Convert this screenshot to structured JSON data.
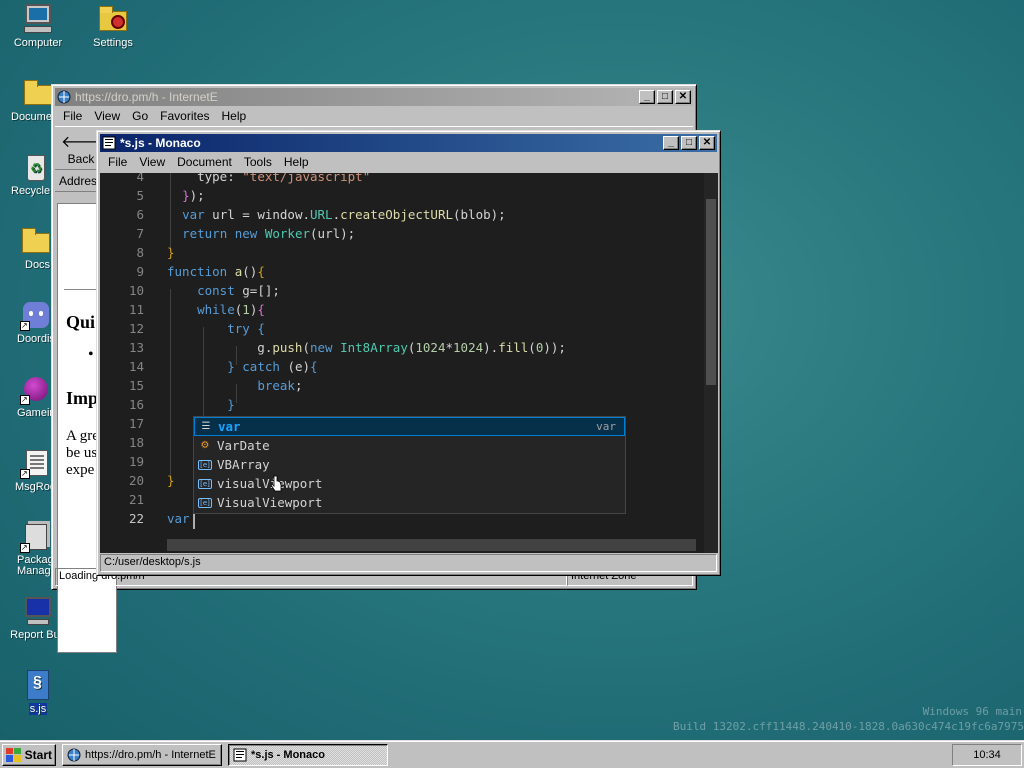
{
  "desktop": {
    "icons": [
      {
        "label": "Computer",
        "icon": "computer-icon"
      },
      {
        "label": "Settings",
        "icon": "settings-icon"
      },
      {
        "label": "Docume",
        "icon": "folder-icon"
      },
      {
        "label": "Recycle",
        "icon": "recycle-bin-icon"
      },
      {
        "label": "Docs",
        "icon": "folder-icon"
      },
      {
        "label": "Doordis",
        "icon": "discord-icon"
      },
      {
        "label": "Gamein",
        "icon": "gamein-icon"
      },
      {
        "label": "MsgRoo",
        "icon": "msgroom-icon"
      },
      {
        "label": "Packag\nManag",
        "icon": "package-manager-icon"
      },
      {
        "label": "Report Bug",
        "icon": "report-bug-icon"
      },
      {
        "label": "s.js",
        "icon": "js-file-icon"
      }
    ]
  },
  "ie_window": {
    "title": "https://dro.pm/h - InternetE",
    "menu": [
      "File",
      "View",
      "Go",
      "Favorites",
      "Help"
    ],
    "back_label": "Back",
    "address_label": "Addres",
    "content": {
      "heading1": "Qui",
      "bullet": "•",
      "heading2": "Imp",
      "para": [
        "A gre",
        "be us",
        "expe"
      ]
    },
    "status_left": "Loading dro.pm/h",
    "status_zone": "Internet Zone"
  },
  "monaco_window": {
    "title": "*s.js - Monaco",
    "menu": [
      "File",
      "View",
      "Document",
      "Tools",
      "Help"
    ],
    "status_path": "C:/user/desktop/s.js",
    "line_numbers": [
      "4",
      "5",
      "6",
      "7",
      "8",
      "9",
      "10",
      "11",
      "12",
      "13",
      "14",
      "15",
      "16",
      "17",
      "18",
      "19",
      "20",
      "21",
      "22"
    ],
    "active_line": "22",
    "suggestions": [
      {
        "pre": "",
        "hl": "var",
        "post": "",
        "detail": "var",
        "kind": "keyword"
      },
      {
        "pre": "",
        "hl": "V",
        "mid": "ar",
        "post": "Date",
        "kind": "class"
      },
      {
        "pre": "",
        "hl": "V",
        "mid": "BAr",
        "post": "ray",
        "kind": "variable"
      },
      {
        "pre": "",
        "hl": "v",
        "mid": "isu",
        "post": "alViewport",
        "kind": "variable"
      },
      {
        "pre": "",
        "hl": "V",
        "mid": "isu",
        "post": "alViewport",
        "kind": "variable"
      }
    ],
    "suggestion_labels": [
      "var",
      "VarDate",
      "VBArray",
      "visualViewport",
      "VisualViewport"
    ],
    "suggestion_detail": "var"
  },
  "watermark": {
    "line1": "Windows 96 main",
    "line2": "Build 13202.cff11448.240410-1828.0a630c474c19fc6a7975"
  },
  "taskbar": {
    "start_label": "Start",
    "tasks": [
      {
        "label": "https://dro.pm/h - InternetE",
        "pressed": false
      },
      {
        "label": "*s.js - Monaco",
        "pressed": true
      }
    ],
    "clock": "10:34"
  },
  "colors": {
    "desktop": "#2a7a80",
    "title_active": "#0a246a",
    "editor_bg": "#1e1e1e",
    "keyword": "#569cd6",
    "string": "#ce9178",
    "number": "#b5cea8",
    "function": "#dcdcaa",
    "class": "#4ec9b0"
  }
}
